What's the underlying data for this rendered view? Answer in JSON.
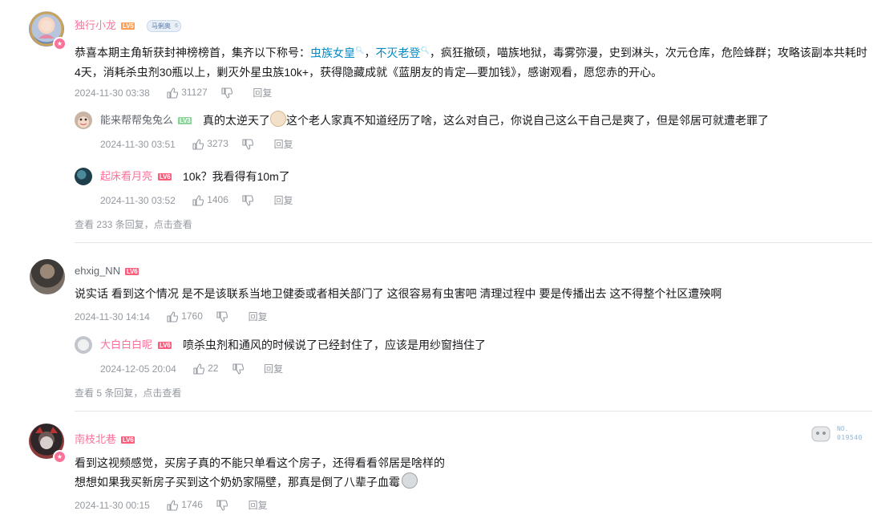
{
  "comments": [
    {
      "username": "独行小龙",
      "level": "LV5",
      "fan_badge": "马俐奥",
      "content_parts": [
        "恭喜本期主角斩获封神榜榜首，集齐以下称号：",
        "虫族女皇",
        "，",
        "不灭老登",
        "，疯狂撤硕，喵族地狱，毒雾弥漫，史到淋头，次元仓库，危险蜂群；攻略该副本共耗时4天，消耗杀虫剂30瓶以上，剿灭外星虫族10k+，获得隐藏成就《蓝朋友的肯定—要加钱》，感谢观看，愿您赤的开心。"
      ],
      "time": "2024-11-30 03:38",
      "likes": "31127",
      "reply_label": "回复",
      "replies": [
        {
          "username": "能来帮帮兔兔么",
          "level": "LV3",
          "content": "真的太逆天了",
          "content_after": "这个老人家真不知道经历了啥，这么对自己，你说自己这么干自己是爽了，但是邻居可就遭老罪了",
          "time": "2024-11-30 03:51",
          "likes": "3273",
          "reply_label": "回复"
        },
        {
          "username": "起床看月亮",
          "level": "LV6",
          "content": "10k？我看得有10m了",
          "time": "2024-11-30 03:52",
          "likes": "1406",
          "reply_label": "回复"
        }
      ],
      "view_more": "查看 233 条回复，点击查看"
    },
    {
      "username": "ehxig_NN",
      "level": "LV6",
      "content": "说实话 看到这个情况 是不是该联系当地卫健委或者相关部门了 这很容易有虫害吧 清理过程中 要是传播出去 这不得整个社区遭殃啊",
      "time": "2024-11-30 14:14",
      "likes": "1760",
      "reply_label": "回复",
      "replies": [
        {
          "username": "大白白白呢",
          "level": "LV6",
          "content": "喷杀虫剂和通风的时候说了已经封住了，应该是用纱窗挡住了",
          "time": "2024-12-05 20:04",
          "likes": "22",
          "reply_label": "回复"
        }
      ],
      "view_more": "查看 5 条回复，点击查看"
    },
    {
      "username": "南枝北巷",
      "level": "LV6",
      "line1": "看到这视频感觉，买房子真的不能只单看这个房子，还得看看邻居是啥样的",
      "line2": "想想如果我买新房子买到这个奶奶家隔壁，那真是倒了八辈子血霉",
      "time": "2024-11-30 00:15",
      "likes": "1746",
      "reply_label": "回复",
      "stamp_no": "NO.",
      "stamp_num": "019540"
    }
  ],
  "colors": {
    "username_pink": "#fb7299",
    "keyword_blue": "#008ac5",
    "meta_gray": "#9499a0",
    "lv5": "#ff9e54",
    "lv6": "#ff5c7c",
    "lv3": "#8bd29b"
  },
  "icons": [
    "like-icon",
    "dislike-icon",
    "search-keyword-icon",
    "emoji-face-icon",
    "emoji-sad-icon"
  ]
}
